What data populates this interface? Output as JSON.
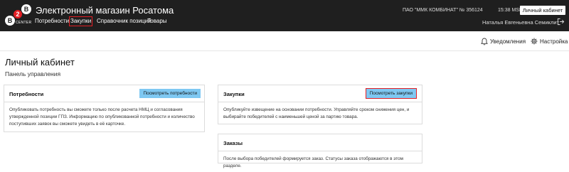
{
  "header": {
    "logo": {
      "b1": "B",
      "num": "2",
      "b3": "B",
      "label": "CENTER"
    },
    "title": "Электронный магазин Росатома",
    "nav": [
      {
        "label": "Потребности"
      },
      {
        "label": "Закупки",
        "active": true
      },
      {
        "label": "Справочник позиций"
      },
      {
        "label": "Товары"
      }
    ],
    "company": "ПАО \"ММК КОМБИНАТ\" № 356124",
    "time": "15:38 MSK",
    "cabinet_button": "Личный кабинет",
    "user_name": "Наталья Евгеньевна Семиклит"
  },
  "subbar": {
    "notifications": "Уведомления",
    "settings": "Настройка"
  },
  "page": {
    "title": "Личный кабинет",
    "subtitle": "Панель управления"
  },
  "cards": {
    "needs": {
      "title": "Потребности",
      "button": "Посмотреть потребности",
      "text": "Опубликовать потребность вы сможете только после расчета НМЦ и согласования утвержденной позиции ГПЗ. Информацию по опубликованной потребности и количество поступивших заявок вы сможете увидеть в её карточке."
    },
    "purchases": {
      "title": "Закупки",
      "button": "Посмотреть закупки",
      "text": "Опубликуйте извещение на основании потребности. Управляйте сроком снижения цен, и выбирайте победителей с наименьшей ценой за партию товара."
    },
    "orders": {
      "title": "Заказы",
      "text": "После выбора победителей формируется заказ. Статусы заказа отображаются в этом разделе."
    }
  },
  "colors": {
    "header_bg": "#1f1f1f",
    "accent_red": "#e31e24",
    "button_blue": "#7ec8f2"
  }
}
